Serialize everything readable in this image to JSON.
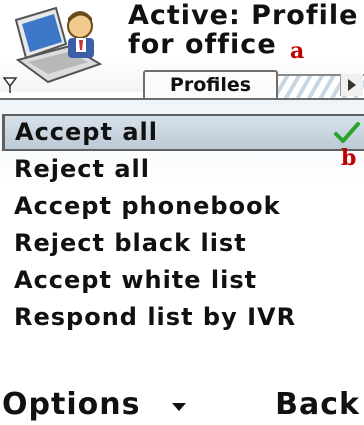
{
  "header": {
    "title_line1": "Active: Profile",
    "title_line2": "for office",
    "callout_a": "a",
    "callout_b": "b"
  },
  "tabs": {
    "active_label": "Profiles"
  },
  "list": {
    "items": [
      {
        "label": "Accept all",
        "selected": true,
        "checked": true
      },
      {
        "label": "Reject all"
      },
      {
        "label": "Accept phonebook"
      },
      {
        "label": "Reject black list"
      },
      {
        "label": "Accept white list"
      },
      {
        "label": "Respond list by IVR"
      }
    ]
  },
  "softkeys": {
    "left": "Options",
    "right": "Back"
  },
  "colors": {
    "selection": "#c8d5e1",
    "check": "#2aa52a",
    "callout": "#c00000"
  },
  "icons": {
    "app": "computer-with-person-icon",
    "check": "check-mark-icon",
    "tab_left": "signal-arrow-icon",
    "tab_right": "chevron-right-icon",
    "softkey_middle": "down-arrow-icon"
  }
}
